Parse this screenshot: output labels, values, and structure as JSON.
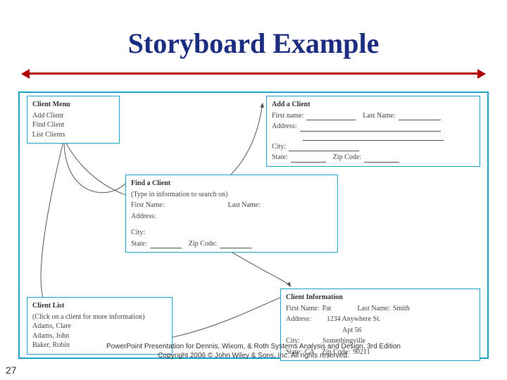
{
  "title": "Storyboard Example",
  "page_number": "27",
  "footer": {
    "line1": "PowerPoint Presentation for Dennis, Wixom, & Roth Systems Analysis and Design, 3rd Edition",
    "line2": "Copyright 2006 © John Wiley & Sons, Inc.  All rights reserved."
  },
  "boxes": {
    "client_menu": {
      "title": "Client Menu",
      "items": [
        "Add Client",
        "Find Client",
        "List Clients"
      ]
    },
    "add_client": {
      "title": "Add a Client",
      "labels": {
        "first": "First name:",
        "last": "Last Name:",
        "addr": "Address:",
        "city": "City:",
        "state": "State:",
        "zip": "Zip Code:"
      }
    },
    "find_client": {
      "title": "Find a Client",
      "subtitle": "(Type in information to search on)",
      "labels": {
        "first": "First Name:",
        "last": "Last Name:",
        "addr": "Address:",
        "city": "City:",
        "state": "State:",
        "zip": "Zip Code:"
      }
    },
    "client_list": {
      "title": "Client List",
      "subtitle": "(Click on a client for more information)",
      "items": [
        "Adams, Clare",
        "Adams, John",
        "Baker, Robin"
      ]
    },
    "client_info": {
      "title": "Client Information",
      "labels": {
        "first": "First Name:",
        "last": "Last Name:",
        "addr": "Address:",
        "city": "City:",
        "state": "State:",
        "zip": "Zip Code:"
      },
      "values": {
        "first": "Pat",
        "last": "Smith",
        "addr1": "1234 Anywhere St.",
        "addr2": "Apt 56",
        "city": "Somethingville",
        "state": "CA",
        "zip": "90211"
      }
    }
  }
}
